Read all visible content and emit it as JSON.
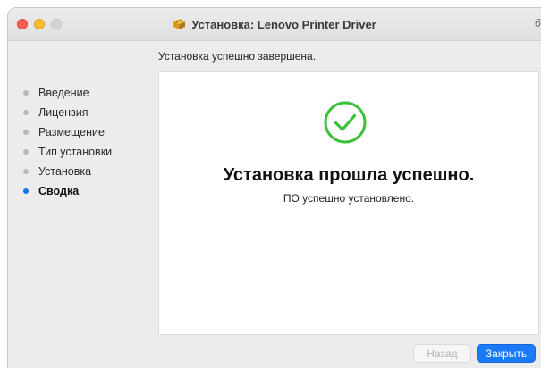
{
  "window": {
    "title": "Установка: Lenovo Printer Driver",
    "edge_glyph": "6"
  },
  "subtitle": "Установка успешно завершена.",
  "sidebar": {
    "steps": [
      {
        "label": "Введение",
        "active": false
      },
      {
        "label": "Лицензия",
        "active": false
      },
      {
        "label": "Размещение",
        "active": false
      },
      {
        "label": "Тип установки",
        "active": false
      },
      {
        "label": "Установка",
        "active": false
      },
      {
        "label": "Сводка",
        "active": true
      }
    ]
  },
  "content": {
    "headline": "Установка прошла успешно.",
    "message": "ПО успешно установлено.",
    "status_icon": "check-circle-icon",
    "success_color": "#3cc13b"
  },
  "buttons": {
    "back_label": "Назад",
    "close_label": "Закрыть"
  },
  "colors": {
    "accent": "#1a7af8",
    "active_step_dot": "#1a73e8"
  }
}
